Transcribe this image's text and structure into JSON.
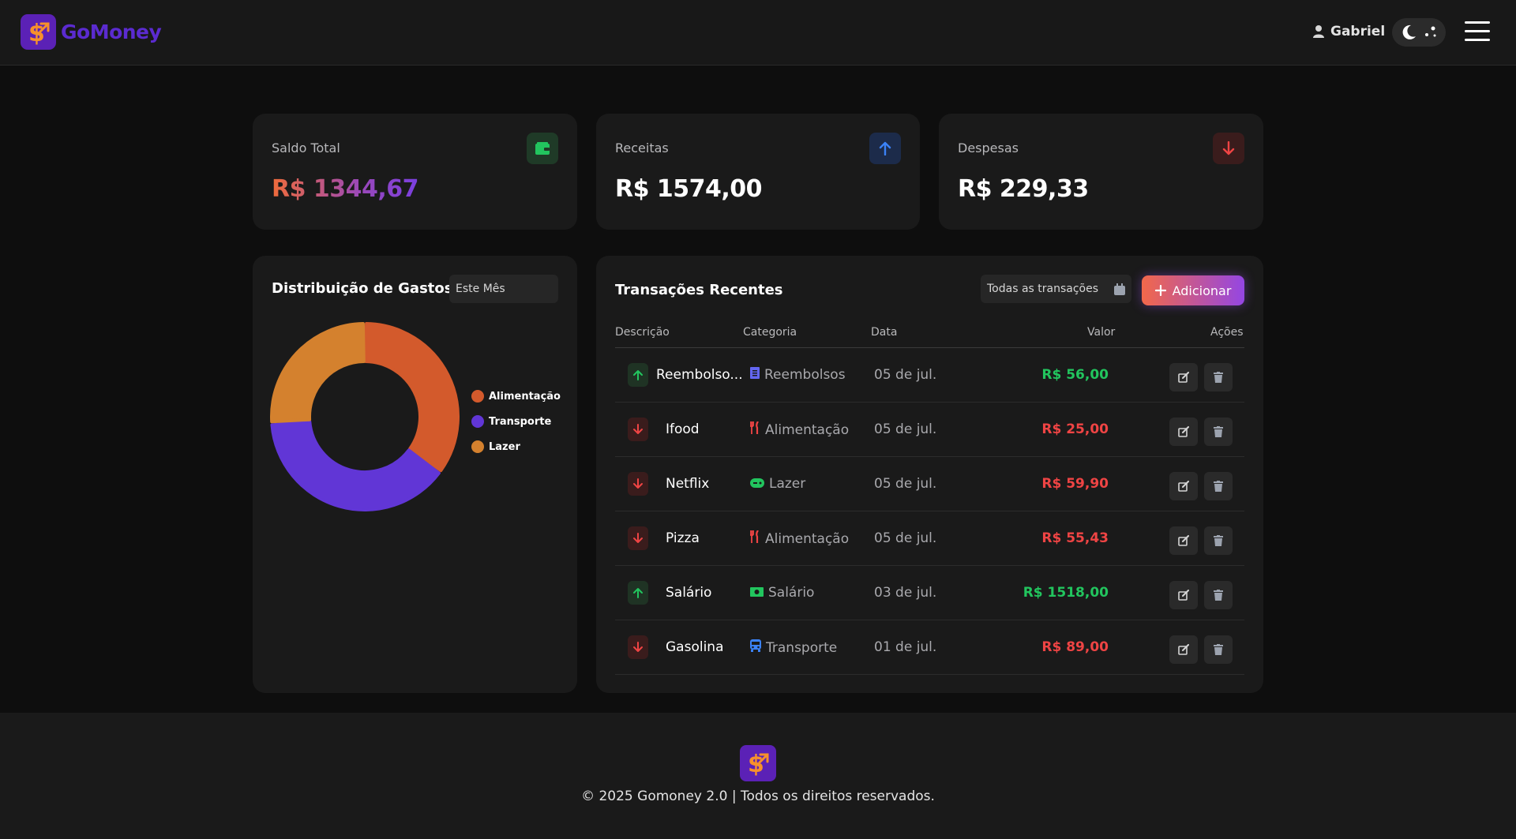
{
  "app": {
    "name": "GoMoney"
  },
  "header": {
    "user": "Gabriel"
  },
  "summary": {
    "saldo": {
      "label": "Saldo Total",
      "value": "R$ 1344,67",
      "icon": "wallet-icon"
    },
    "receitas": {
      "label": "Receitas",
      "value": "R$ 1574,00",
      "icon": "arrow-up-icon"
    },
    "despesas": {
      "label": "Despesas",
      "value": "R$ 229,33",
      "icon": "arrow-down-icon"
    }
  },
  "distribution": {
    "title": "Distribuição de Gastos",
    "period": "Este Mês"
  },
  "chart_data": {
    "type": "pie",
    "donut": true,
    "categories": [
      "Alimentação",
      "Transporte",
      "Lazer"
    ],
    "values": [
      80.43,
      89.0,
      59.9
    ],
    "colors": [
      "#d35a2c",
      "#6136d6",
      "#d4812e"
    ],
    "legend": "right"
  },
  "transactions": {
    "title": "Transações Recentes",
    "filter": "Todas as transações",
    "add_label": "Adicionar",
    "columns": {
      "desc": "Descrição",
      "cat": "Categoria",
      "date": "Data",
      "value": "Valor",
      "actions": "Ações"
    },
    "rows": [
      {
        "type": "in",
        "desc": "Reembolso...",
        "cat": "Reembolsos",
        "cat_icon": "receipt-icon",
        "cat_color": "#6366f1",
        "date": "05 de jul.",
        "value": "R$ 56,00"
      },
      {
        "type": "out",
        "desc": "Ifood",
        "cat": "Alimentação",
        "cat_icon": "utensils-icon",
        "cat_color": "#ef4444",
        "date": "05 de jul.",
        "value": "R$ 25,00"
      },
      {
        "type": "out",
        "desc": "Netflix",
        "cat": "Lazer",
        "cat_icon": "gamepad-icon",
        "cat_color": "#22c55e",
        "date": "05 de jul.",
        "value": "R$ 59,90"
      },
      {
        "type": "out",
        "desc": "Pizza",
        "cat": "Alimentação",
        "cat_icon": "utensils-icon",
        "cat_color": "#ef4444",
        "date": "05 de jul.",
        "value": "R$ 55,43"
      },
      {
        "type": "in",
        "desc": "Salário",
        "cat": "Salário",
        "cat_icon": "money-icon",
        "cat_color": "#22c55e",
        "date": "03 de jul.",
        "value": "R$ 1518,00"
      },
      {
        "type": "out",
        "desc": "Gasolina",
        "cat": "Transporte",
        "cat_icon": "bus-icon",
        "cat_color": "#3b82f6",
        "date": "01 de jul.",
        "value": "R$ 89,00"
      }
    ]
  },
  "colors": {
    "income": "#22c55e",
    "expense": "#ef4444",
    "brand": "#5b21b6"
  },
  "footer": {
    "text": "© 2025 Gomoney 2.0 | Todos os direitos reservados."
  }
}
